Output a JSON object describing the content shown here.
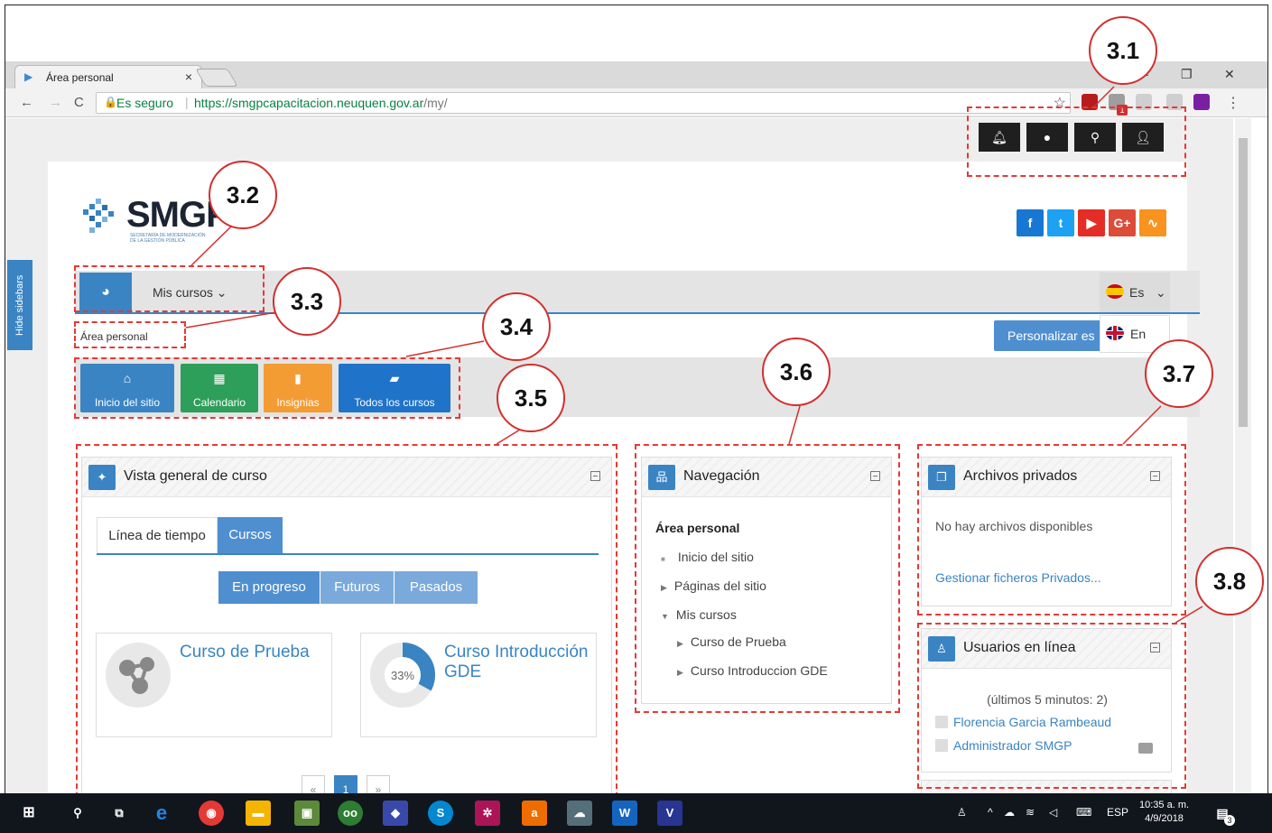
{
  "browser": {
    "tab_title": "Área personal",
    "tab_close": "×",
    "security_label": "Es seguro",
    "url_host": "https://smgpcapacitacion.neuquen.gov.ar",
    "url_path": "/my/",
    "ext_badge": "1"
  },
  "sidebar_toggle": "Hide sidebars",
  "logo": {
    "word": "SMGP",
    "subtitle": "SECRETARÍA DE MODERNIZACIÓN DE LA GESTIÓN PÚBLICA"
  },
  "social": [
    {
      "label": "f",
      "color": "#1877d2"
    },
    {
      "label": "t",
      "color": "#1da1f2"
    },
    {
      "label": "▶",
      "color": "#e52d27"
    },
    {
      "label": "G+",
      "color": "#dd4b39"
    },
    {
      "label": "rss",
      "color": "#f7931e"
    }
  ],
  "nav": {
    "my_courses": "Mis cursos ⌄"
  },
  "language": {
    "current": "Es",
    "chevron": "⌄",
    "option": "En"
  },
  "customize_button": "Personalizar es",
  "breadcrumb": "Área personal",
  "quick_buttons": [
    {
      "label": "Inicio del sitio",
      "color": "#3a84c4",
      "icon": "home-icon"
    },
    {
      "label": "Calendario",
      "color": "#2e9e5b",
      "icon": "calendar-icon"
    },
    {
      "label": "Insignias",
      "color": "#f39c34",
      "icon": "bookmark-icon"
    },
    {
      "label": "Todos los cursos",
      "color": "#1f73c8",
      "icon": "book-icon"
    }
  ],
  "course_overview": {
    "title": "Vista general de curso",
    "tab_timeline": "Línea de tiempo",
    "tab_courses": "Cursos",
    "filters": [
      "En progreso",
      "Futuros",
      "Pasados"
    ],
    "courses": [
      {
        "name": "Curso de Prueba",
        "progress_label": ""
      },
      {
        "name": "Curso Introducción GDE",
        "progress_label": "33%",
        "progress": 33
      }
    ],
    "pager": [
      "«",
      "1",
      "»"
    ]
  },
  "navigation": {
    "title": "Navegación",
    "items": [
      {
        "label": "Área personal",
        "marker": ""
      },
      {
        "label": "Inicio del sitio",
        "marker": "■"
      },
      {
        "label": "Páginas del sitio",
        "marker": "▶"
      },
      {
        "label": "Mis cursos",
        "marker": "▼"
      },
      {
        "label": "Curso de Prueba",
        "marker": "▶"
      },
      {
        "label": "Curso Introduccion GDE",
        "marker": "▶"
      }
    ]
  },
  "private_files": {
    "title": "Archivos privados",
    "empty": "No hay archivos disponibles",
    "manage_link": "Gestionar ficheros Privados..."
  },
  "online_users": {
    "title": "Usuarios en línea",
    "summary": "(últimos 5 minutos: 2)",
    "users": [
      "Florencia Garcia Rambeaud",
      "Administrador SMGP"
    ]
  },
  "annotations": [
    "3.1",
    "3.2",
    "3.3",
    "3.4",
    "3.5",
    "3.6",
    "3.7",
    "3.8"
  ],
  "taskbar": {
    "lang": "ESP",
    "time": "10:35 a. m.",
    "date": "4/9/2018",
    "notif_count": "3"
  },
  "colors": {
    "accent": "#3a84c4",
    "annotation": "#e53935"
  }
}
